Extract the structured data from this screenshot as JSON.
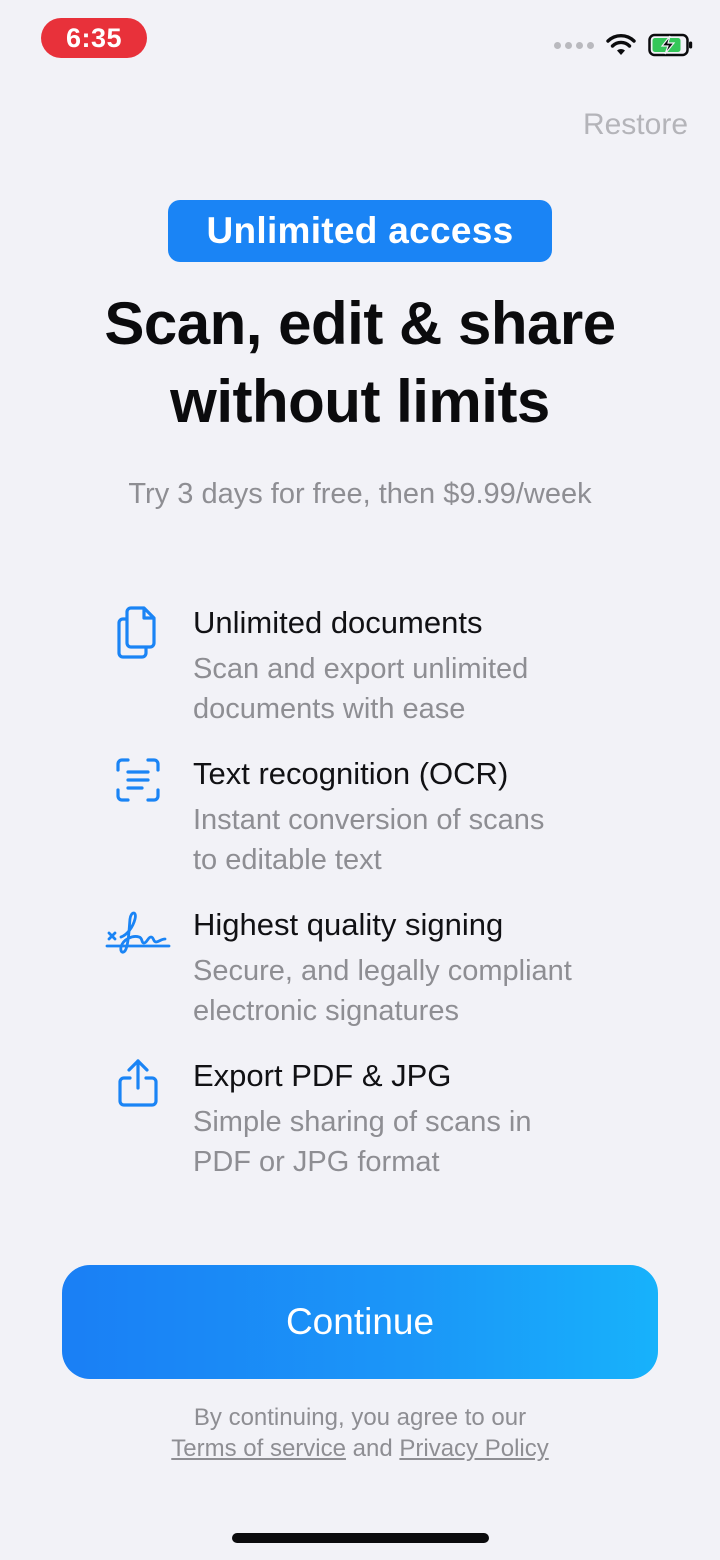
{
  "status_bar": {
    "time": "6:35"
  },
  "header": {
    "restore_label": "Restore"
  },
  "hero": {
    "badge": "Unlimited access",
    "headline_line1": "Scan, edit & share",
    "headline_line2": "without limits",
    "subtitle": "Try 3 days for free, then $9.99/week"
  },
  "features": [
    {
      "icon": "documents-icon",
      "title": "Unlimited documents",
      "desc_line1": "Scan and export unlimited",
      "desc_line2": "documents with ease"
    },
    {
      "icon": "text-scan-icon",
      "title": "Text recognition (OCR)",
      "desc_line1": "Instant conversion of scans",
      "desc_line2": "to editable text"
    },
    {
      "icon": "signature-icon",
      "title": "Highest quality signing",
      "desc_line1": "Secure, and legally compliant",
      "desc_line2": "electronic signatures"
    },
    {
      "icon": "share-icon",
      "title": "Export PDF & JPG",
      "desc_line1": "Simple sharing of scans in",
      "desc_line2": "PDF or JPG format"
    }
  ],
  "cta": {
    "continue_label": "Continue"
  },
  "legal": {
    "line1": "By continuing, you agree to our",
    "terms_label": "Terms of service",
    "and_label": "and",
    "privacy_label": "Privacy Policy"
  },
  "colors": {
    "accent": "#1a84f5",
    "background": "#f2f2f7",
    "status_time_bg": "#e8313a",
    "secondary_text": "#8e8e93"
  }
}
